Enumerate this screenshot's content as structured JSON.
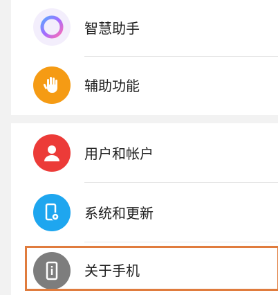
{
  "colors": {
    "assistant_icon": "#9b6bff",
    "accessibility_icon": "#f59b14",
    "users_icon": "#ec3b38",
    "update_icon": "#1ea6ef",
    "about_icon": "#7d7d7d",
    "highlight": "#e07c3e"
  },
  "settings": {
    "group1": [
      {
        "label": "智慧助手",
        "icon": "assistant-ring-icon"
      },
      {
        "label": "辅助功能",
        "icon": "hand-icon"
      }
    ],
    "group2": [
      {
        "label": "用户和帐户",
        "icon": "person-icon"
      },
      {
        "label": "系统和更新",
        "icon": "phone-gear-icon"
      },
      {
        "label": "关于手机",
        "icon": "phone-info-icon"
      }
    ]
  }
}
